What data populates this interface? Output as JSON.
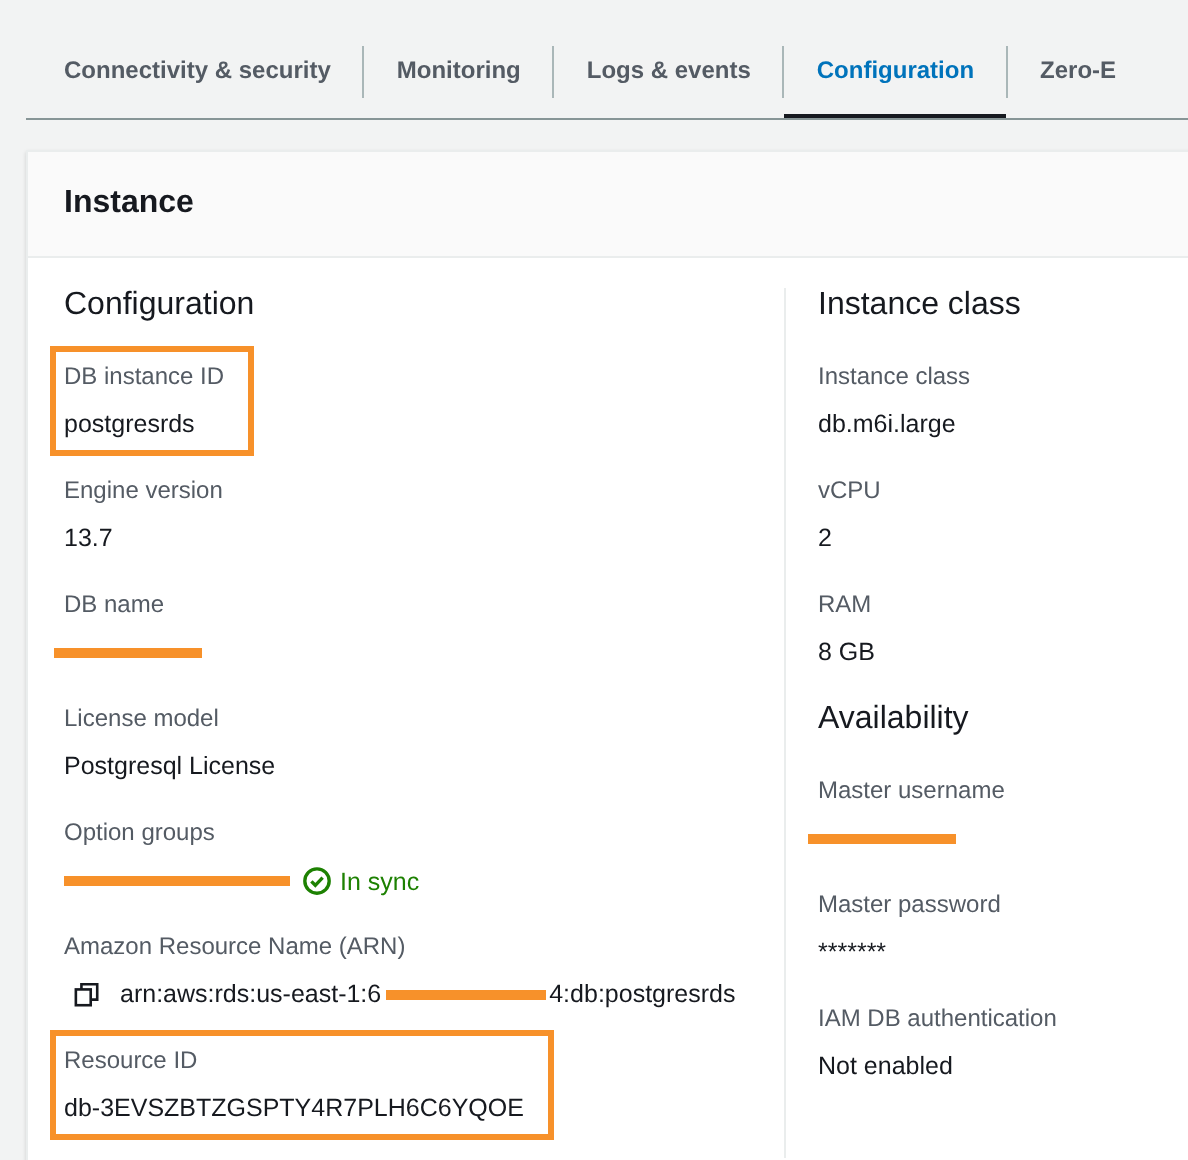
{
  "tabs": [
    {
      "label": "Connectivity & security",
      "selected": false
    },
    {
      "label": "Monitoring",
      "selected": false
    },
    {
      "label": "Logs & events",
      "selected": false
    },
    {
      "label": "Configuration",
      "selected": true
    },
    {
      "label": "Zero-E",
      "selected": false
    }
  ],
  "panel": {
    "title": "Instance",
    "columns": [
      {
        "sections": [
          {
            "title": "Configuration",
            "fields": [
              {
                "label": "DB instance ID",
                "kind": "text",
                "value": "postgresrds",
                "highlighted": true
              },
              {
                "label": "Engine version",
                "kind": "text",
                "value": "13.7",
                "highlighted": false
              },
              {
                "label": "DB name",
                "kind": "redacted",
                "highlighted": false
              },
              {
                "label": "License model",
                "kind": "text",
                "value": "Postgresql License",
                "highlighted": false
              },
              {
                "label": "Option groups",
                "kind": "redacted_status",
                "status": "In sync",
                "highlighted": false
              },
              {
                "label": "Amazon Resource Name (ARN)",
                "kind": "arn",
                "value": "arn:aws:rds:us-east-1:6",
                "value_after": "4:db:postgresrds",
                "highlighted": false
              },
              {
                "label": "Resource ID",
                "kind": "text",
                "value": "db-3EVSZBTZGSPTY4R7PLH6C6YQOE",
                "highlighted": true
              }
            ]
          }
        ]
      },
      {
        "sections": [
          {
            "title": "Instance class",
            "fields": [
              {
                "label": "Instance class",
                "kind": "text",
                "value": "db.m6i.large",
                "highlighted": false
              },
              {
                "label": "vCPU",
                "kind": "text",
                "value": "2",
                "highlighted": false
              },
              {
                "label": "RAM",
                "kind": "text",
                "value": "8 GB",
                "highlighted": false
              }
            ]
          },
          {
            "title": "Availability",
            "fields": [
              {
                "label": "Master username",
                "kind": "redacted",
                "highlighted": false
              },
              {
                "label": "Master password",
                "kind": "text",
                "value": "*******",
                "highlighted": false
              },
              {
                "label": "IAM DB authentication",
                "kind": "text",
                "value": "Not enabled",
                "highlighted": false
              }
            ]
          }
        ]
      }
    ]
  }
}
